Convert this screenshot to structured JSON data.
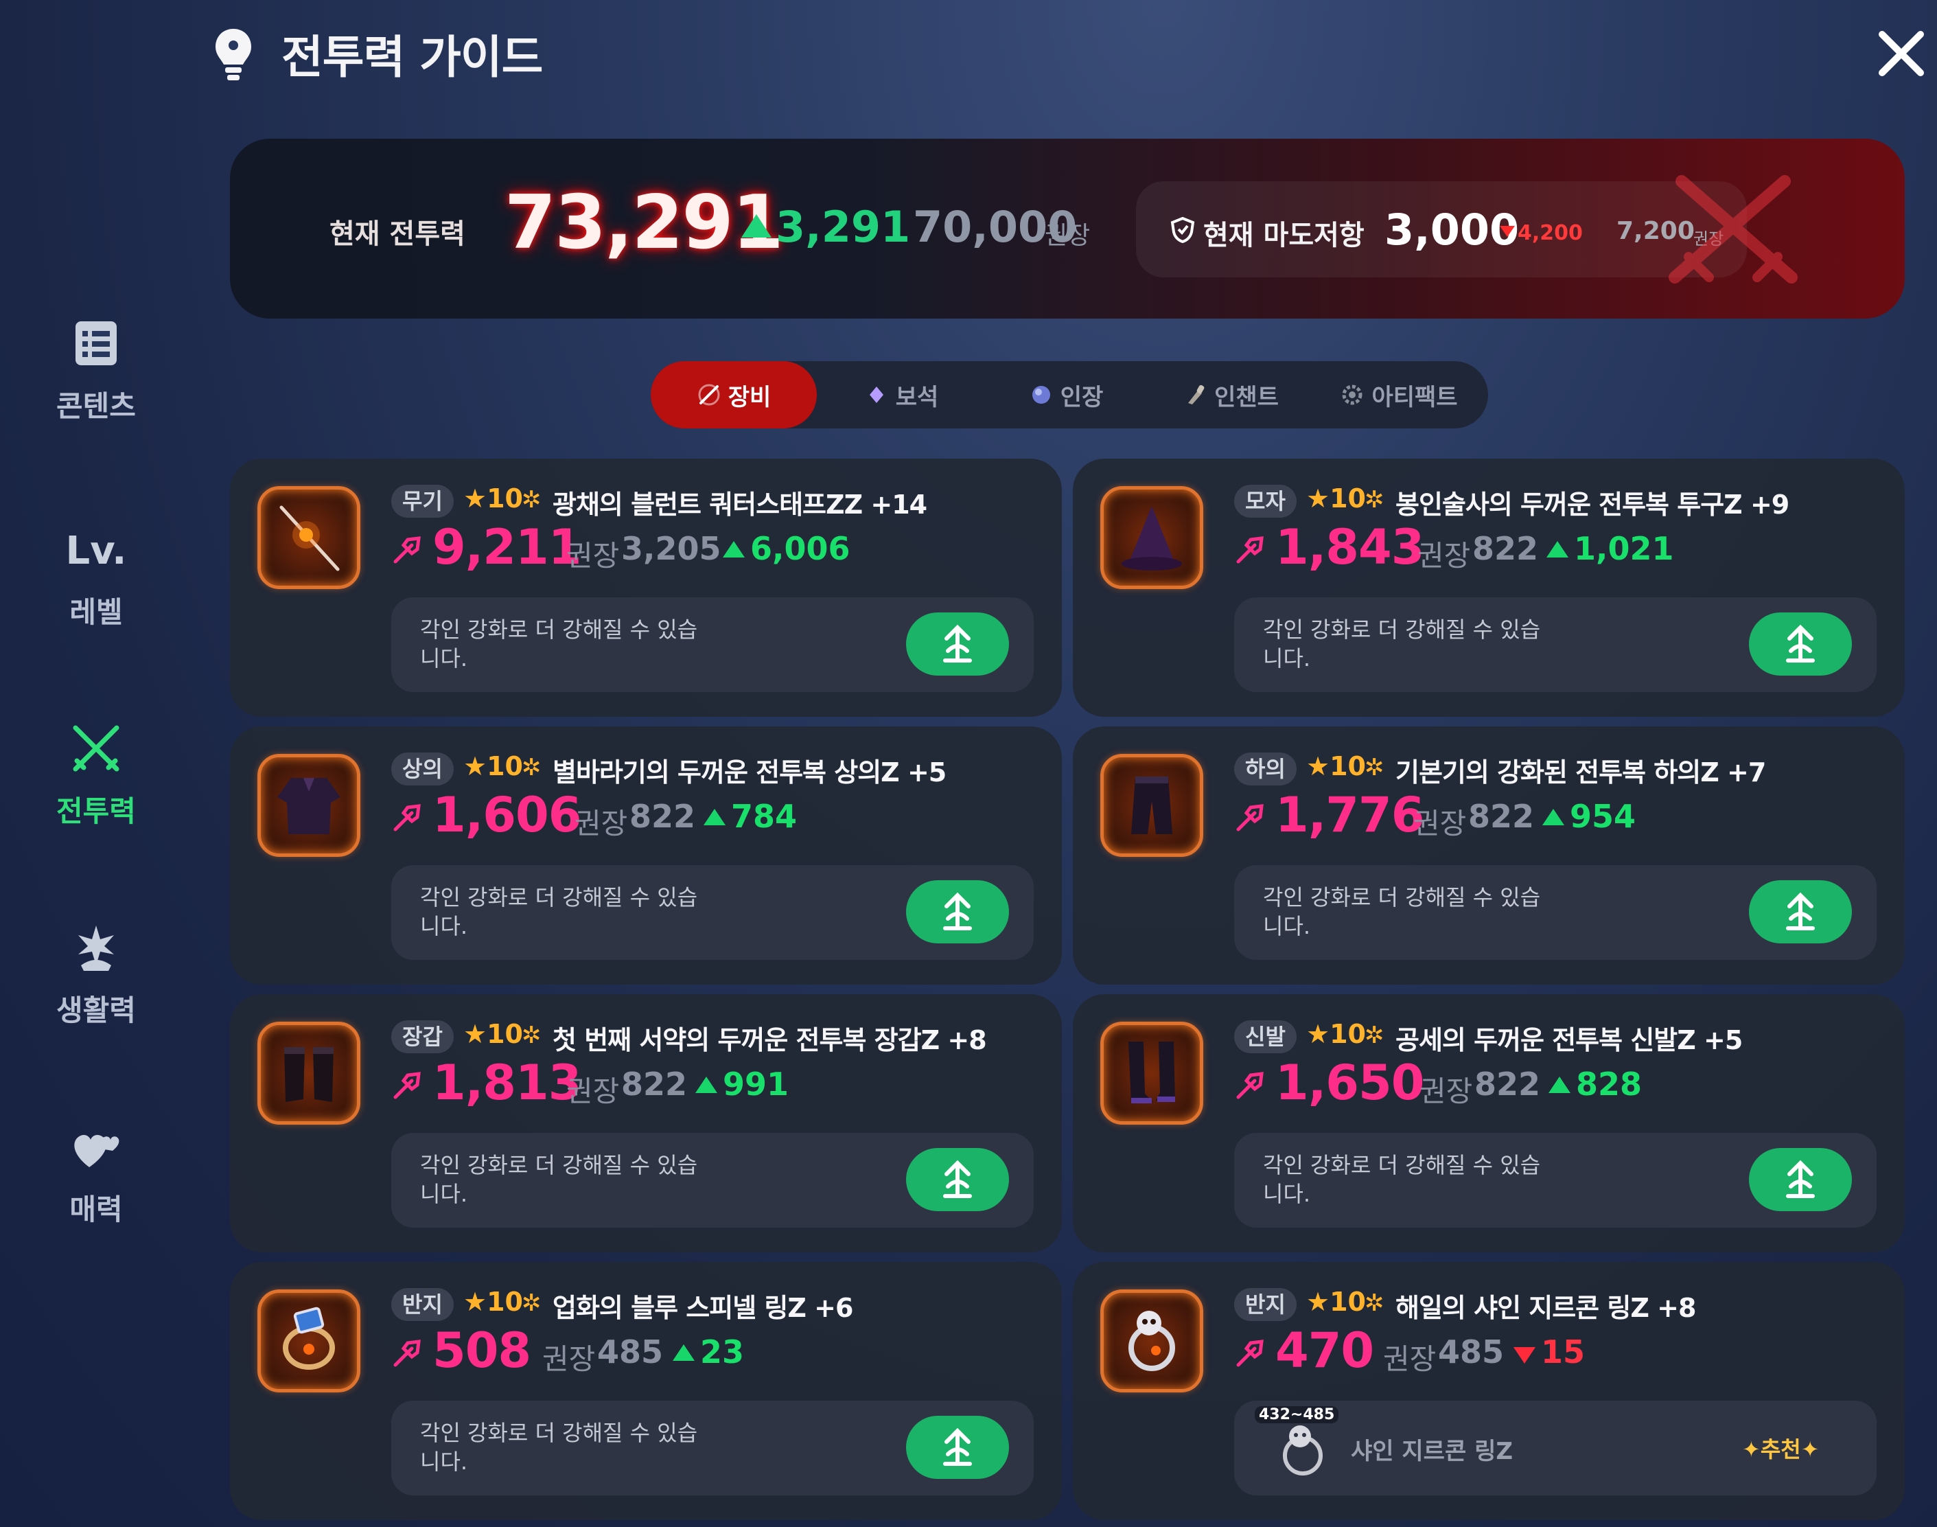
{
  "header": {
    "title": "전투력 가이드",
    "bulb_icon": "lightbulb-icon",
    "close_icon": "close-icon"
  },
  "sidebar": {
    "items": [
      {
        "label": "콘텐츠",
        "icon": "checklist-icon",
        "active": false
      },
      {
        "label": "레벨",
        "icon_text": "Lv.",
        "active": false
      },
      {
        "label": "전투력",
        "icon": "crossed-swords-icon",
        "active": true
      },
      {
        "label": "생활력",
        "icon": "sprout-icon",
        "active": false
      },
      {
        "label": "매력",
        "icon": "heart-icon",
        "active": false
      }
    ],
    "active_color": "#2fe07a"
  },
  "banner": {
    "label": "현재 전투력",
    "power": "73,291",
    "up": "3,291",
    "recommended": "70,000",
    "recommended_label": "권장",
    "mado_label": "현재 마도저항",
    "mado_value": "3,000",
    "mado_down": "4,200",
    "mado_recommended": "7,200",
    "mado_recommended_label": "권장"
  },
  "tabs": [
    {
      "label": "장비",
      "icon": "sword-icon",
      "active": true
    },
    {
      "label": "보석",
      "icon": "gem-icon",
      "active": false
    },
    {
      "label": "인장",
      "icon": "seal-icon",
      "active": false
    },
    {
      "label": "인챈트",
      "icon": "enchant-brush-icon",
      "active": false
    },
    {
      "label": "아티팩트",
      "icon": "artifact-icon",
      "active": false
    }
  ],
  "items": [
    {
      "slot": "무기",
      "star": "★10",
      "name": "광채의 블런트 쿼터스태프ZZ +14",
      "power": "9,211",
      "rec_label": "권장",
      "rec": "3,205",
      "diff": "6,006",
      "diff_dir": "up",
      "hint": "각인 강화로 더 강해질 수 있습니다.",
      "icon": "staff-icon"
    },
    {
      "slot": "모자",
      "star": "★10",
      "name": "봉인술사의 두꺼운 전투복 투구Z +9",
      "power": "1,843",
      "rec_label": "권장",
      "rec": "822",
      "diff": "1,021",
      "diff_dir": "up",
      "hint": "각인 강화로 더 강해질 수 있습니다.",
      "icon": "hat-icon"
    },
    {
      "slot": "상의",
      "star": "★10",
      "name": "별바라기의 두꺼운 전투복 상의Z +5",
      "power": "1,606",
      "rec_label": "권장",
      "rec": "822",
      "diff": "784",
      "diff_dir": "up",
      "hint": "각인 강화로 더 강해질 수 있습니다.",
      "icon": "top-armor-icon"
    },
    {
      "slot": "하의",
      "star": "★10",
      "name": "기본기의 강화된 전투복 하의Z +7",
      "power": "1,776",
      "rec_label": "권장",
      "rec": "822",
      "diff": "954",
      "diff_dir": "up",
      "hint": "각인 강화로 더 강해질 수 있습니다.",
      "icon": "pants-icon"
    },
    {
      "slot": "장갑",
      "star": "★10",
      "name": "첫 번째 서약의 두꺼운 전투복 장갑Z +8",
      "power": "1,813",
      "rec_label": "권장",
      "rec": "822",
      "diff": "991",
      "diff_dir": "up",
      "hint": "각인 강화로 더 강해질 수 있습니다.",
      "icon": "gloves-icon"
    },
    {
      "slot": "신발",
      "star": "★10",
      "name": "공세의 두꺼운 전투복 신발Z +5",
      "power": "1,650",
      "rec_label": "권장",
      "rec": "822",
      "diff": "828",
      "diff_dir": "up",
      "hint": "각인 강화로 더 강해질 수 있습니다.",
      "icon": "boots-icon"
    },
    {
      "slot": "반지",
      "star": "★10",
      "name": "업화의 블루 스피넬 링Z +6",
      "power": "508",
      "rec_label": "권장",
      "rec": "485",
      "diff": "23",
      "diff_dir": "up",
      "hint": "각인 강화로 더 강해질 수 있습니다.",
      "icon": "blue-ring-icon"
    },
    {
      "slot": "반지",
      "star": "★10",
      "name": "해일의 샤인 지르콘 링Z +8",
      "power": "470",
      "rec_label": "권장",
      "rec": "485",
      "diff": "15",
      "diff_dir": "down",
      "recommend": {
        "range": "432~485",
        "name": "샤인 지르콘 링Z",
        "badge": "✦추천✦"
      },
      "icon": "skull-ring-icon"
    }
  ],
  "colors": {
    "power_pink": "#ff2d8a",
    "up_green": "#19e06a",
    "down_red": "#ff3344",
    "button_green": "#1bb368",
    "tab_active": "#b80f0f"
  }
}
